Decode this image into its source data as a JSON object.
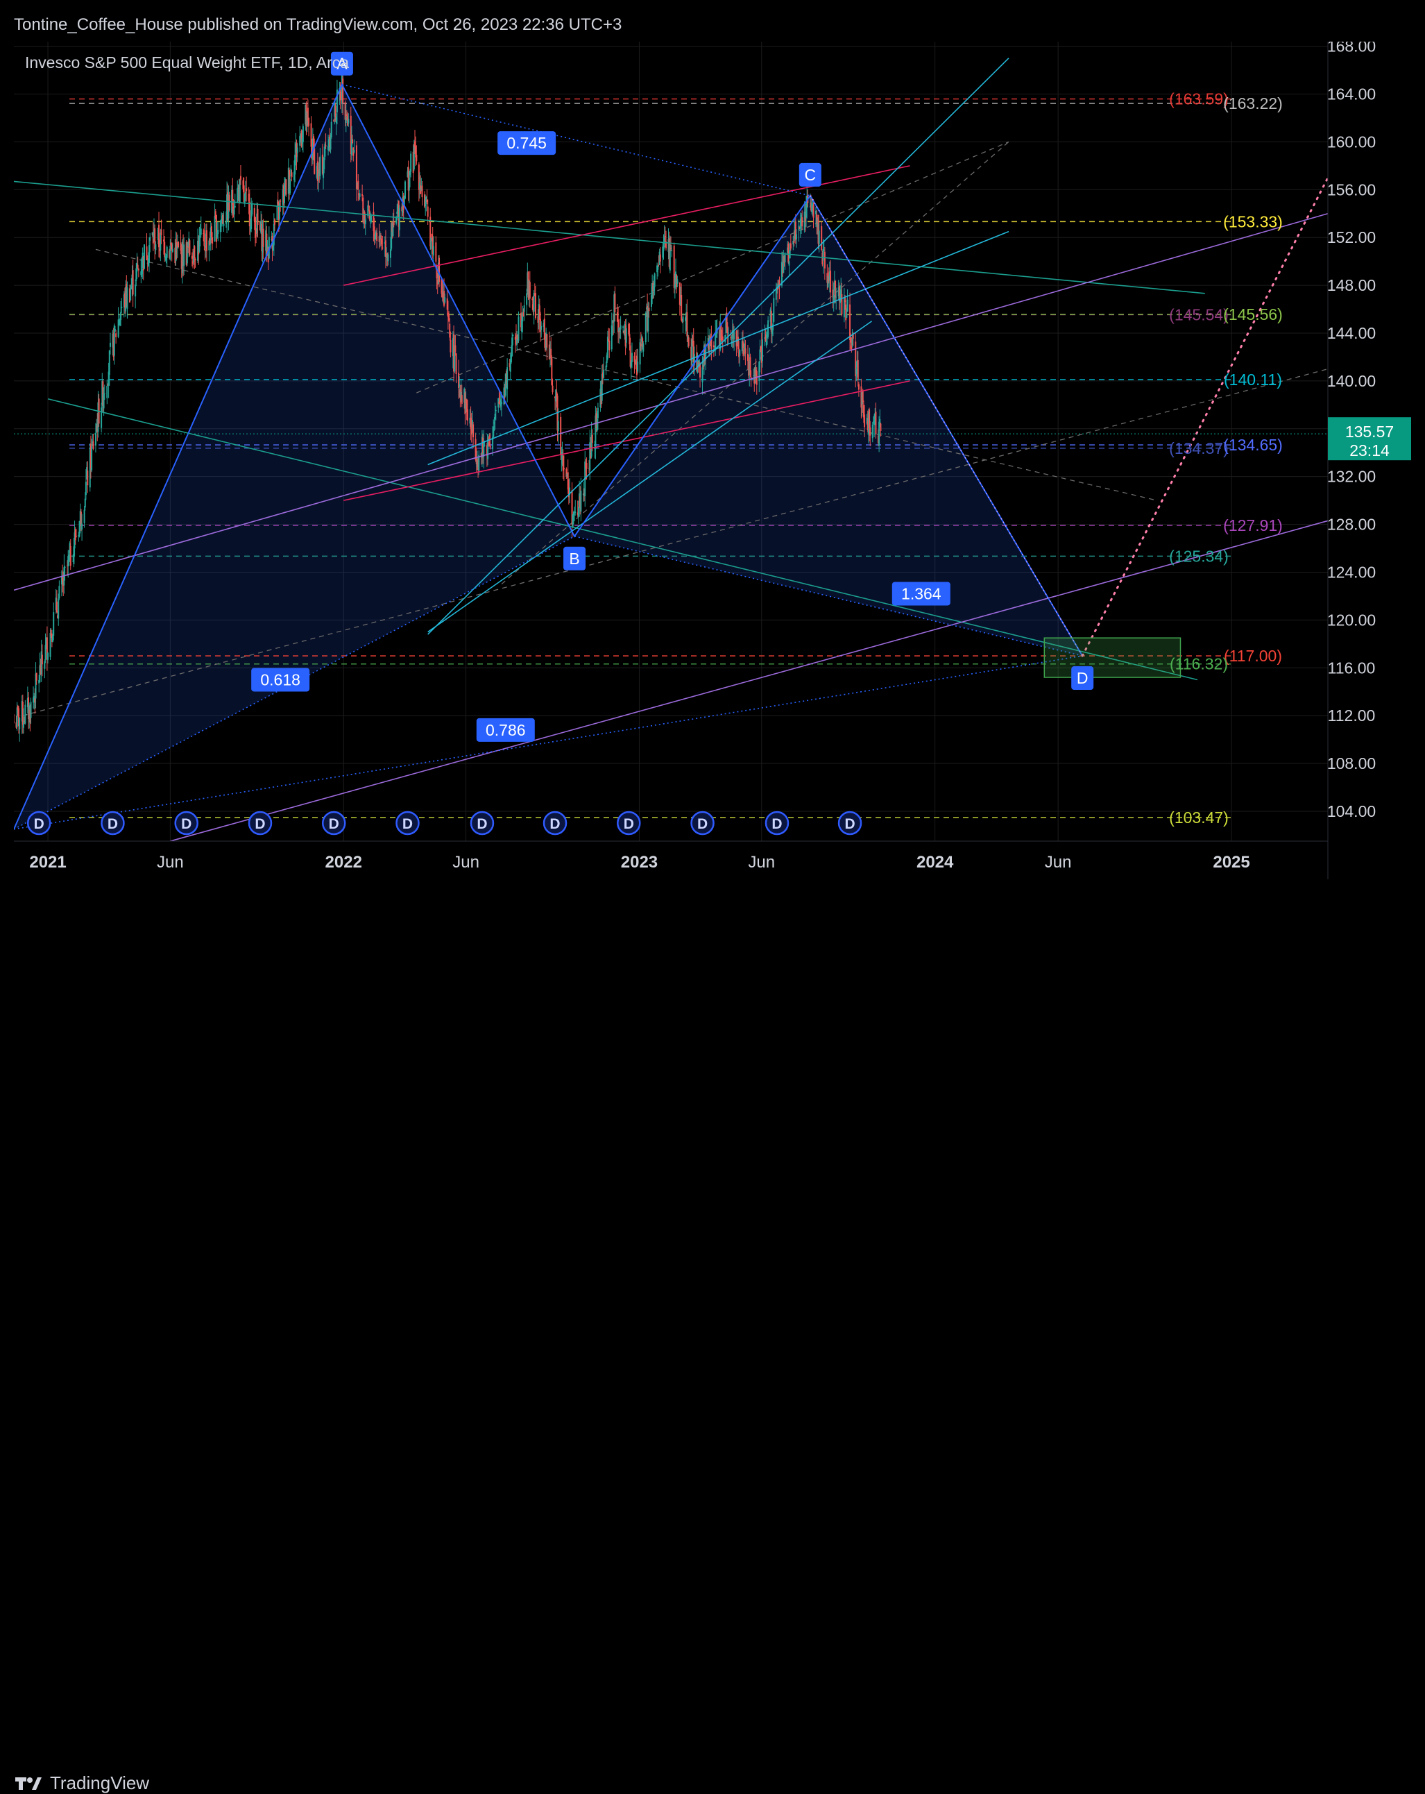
{
  "header": {
    "publisher_line": "Tontine_Coffee_House published on TradingView.com, Oct 26, 2023 22:36 UTC+3"
  },
  "footer": {
    "brand": "TradingView"
  },
  "colors": {
    "background": "#000000",
    "grid": "#1c1c1c",
    "axis_text": "#d1d4dc",
    "candle_up": "#26a69a",
    "candle_down": "#ef5350",
    "pattern_blue": "#2962ff",
    "teal_line": "#1b9e8e",
    "cyan_line": "#23b7d8",
    "pink_line": "#e91e63",
    "purple_line": "#9c6bdc",
    "target_box": "#3fa34d",
    "last_price_bg": "#089981"
  },
  "chart_data": {
    "type": "candlestick",
    "title": "Invesco S&P 500 Equal Weight ETF, 1D, Arca",
    "x_range": [
      "2020-11-20",
      "2025-04-30"
    ],
    "ylim": [
      101.5,
      168.5
    ],
    "y_ticks": [
      104,
      108,
      112,
      116,
      120,
      124,
      128,
      132,
      136,
      140,
      144,
      148,
      152,
      156,
      160,
      164,
      168
    ],
    "y_tick_labels": [
      "104.00",
      "108.00",
      "112.00",
      "116.00",
      "120.00",
      "124.00",
      "128.00",
      "132.00",
      "136.00",
      "140.00",
      "144.00",
      "148.00",
      "152.00",
      "156.00",
      "160.00",
      "164.00",
      "168.00"
    ],
    "x_ticks": [
      {
        "date": "2021-01-01",
        "label": "2021",
        "bold": true
      },
      {
        "date": "2021-06-01",
        "label": "Jun",
        "bold": false
      },
      {
        "date": "2022-01-01",
        "label": "2022",
        "bold": true
      },
      {
        "date": "2022-06-01",
        "label": "Jun",
        "bold": false
      },
      {
        "date": "2023-01-01",
        "label": "2023",
        "bold": true
      },
      {
        "date": "2023-06-01",
        "label": "Jun",
        "bold": false
      },
      {
        "date": "2024-01-01",
        "label": "2024",
        "bold": true
      },
      {
        "date": "2024-06-01",
        "label": "Jun",
        "bold": false
      },
      {
        "date": "2025-01-01",
        "label": "2025",
        "bold": true
      }
    ],
    "last_price": {
      "value": 135.57,
      "label": "135.57",
      "countdown": "23:14"
    },
    "price_path": [
      {
        "date": "2020-11-20",
        "value": 111.5
      },
      {
        "date": "2020-12-10",
        "value": 112.5
      },
      {
        "date": "2021-01-10",
        "value": 120.5
      },
      {
        "date": "2021-02-10",
        "value": 128.5
      },
      {
        "date": "2021-03-05",
        "value": 137.5
      },
      {
        "date": "2021-04-01",
        "value": 146.0
      },
      {
        "date": "2021-05-10",
        "value": 152.0
      },
      {
        "date": "2021-06-15",
        "value": 150.5
      },
      {
        "date": "2021-07-20",
        "value": 152.0
      },
      {
        "date": "2021-08-25",
        "value": 156.0
      },
      {
        "date": "2021-09-30",
        "value": 151.0
      },
      {
        "date": "2021-11-15",
        "value": 162.0
      },
      {
        "date": "2021-12-01",
        "value": 157.0
      },
      {
        "date": "2021-12-30",
        "value": 164.8
      },
      {
        "date": "2022-01-25",
        "value": 154.0
      },
      {
        "date": "2022-02-25",
        "value": 151.0
      },
      {
        "date": "2022-03-30",
        "value": 159.0
      },
      {
        "date": "2022-04-25",
        "value": 150.0
      },
      {
        "date": "2022-05-20",
        "value": 141.0
      },
      {
        "date": "2022-06-17",
        "value": 133.5
      },
      {
        "date": "2022-07-05",
        "value": 136.0
      },
      {
        "date": "2022-08-16",
        "value": 148.0
      },
      {
        "date": "2022-09-10",
        "value": 143.0
      },
      {
        "date": "2022-09-30",
        "value": 133.0
      },
      {
        "date": "2022-10-13",
        "value": 128.0
      },
      {
        "date": "2022-11-05",
        "value": 135.0
      },
      {
        "date": "2022-12-01",
        "value": 146.0
      },
      {
        "date": "2022-12-28",
        "value": 141.0
      },
      {
        "date": "2023-02-02",
        "value": 152.0
      },
      {
        "date": "2023-03-13",
        "value": 141.0
      },
      {
        "date": "2023-04-18",
        "value": 145.0
      },
      {
        "date": "2023-05-25",
        "value": 140.0
      },
      {
        "date": "2023-06-30",
        "value": 150.0
      },
      {
        "date": "2023-07-31",
        "value": 155.5
      },
      {
        "date": "2023-08-25",
        "value": 148.0
      },
      {
        "date": "2023-09-15",
        "value": 146.0
      },
      {
        "date": "2023-10-05",
        "value": 137.0
      },
      {
        "date": "2023-10-26",
        "value": 135.57
      }
    ],
    "horizontal_levels": [
      {
        "value": 163.59,
        "label": "(163.59)",
        "color": "#e53935",
        "label_side": "inner"
      },
      {
        "value": 163.22,
        "label": "(163.22)",
        "color": "#bdbdbd",
        "label_side": "outer"
      },
      {
        "value": 153.33,
        "label": "(153.33)",
        "color": "#ffeb3b",
        "label_side": "outer"
      },
      {
        "value": 145.54,
        "label": "(145.54)",
        "color": "#8e3b7c",
        "label_side": "inner"
      },
      {
        "value": 145.56,
        "label": "(145.56)",
        "color": "#8bc34a",
        "label_side": "outer"
      },
      {
        "value": 140.11,
        "label": "(140.11)",
        "color": "#00bcd4",
        "label_side": "outer"
      },
      {
        "value": 134.37,
        "label": "(134.37)",
        "color": "#3f51b5",
        "label_side": "inner"
      },
      {
        "value": 134.65,
        "label": "(134.65)",
        "color": "#536dfe",
        "label_side": "outer"
      },
      {
        "value": 127.91,
        "label": "(127.91)",
        "color": "#ab47bc",
        "label_side": "outer"
      },
      {
        "value": 125.34,
        "label": "(125.34)",
        "color": "#26a69a",
        "label_side": "inner"
      },
      {
        "value": 117.0,
        "label": "(117.00)",
        "color": "#f44336",
        "label_side": "outer"
      },
      {
        "value": 116.32,
        "label": "(116.32)",
        "color": "#4caf50",
        "label_side": "inner"
      },
      {
        "value": 103.47,
        "label": "(103.47)",
        "color": "#cddc39",
        "label_side": "inner"
      }
    ],
    "harmonic_points": [
      {
        "label": "A",
        "date": "2021-12-30",
        "value": 164.8,
        "label_pos": "above"
      },
      {
        "label": "B",
        "date": "2022-10-13",
        "value": 127.0,
        "label_pos": "below"
      },
      {
        "label": "C",
        "date": "2023-07-31",
        "value": 155.5,
        "label_pos": "above"
      },
      {
        "label": "D",
        "date": "2024-07-01",
        "value": 117.0,
        "label_pos": "below"
      }
    ],
    "ratios": [
      {
        "label": "0.745",
        "date": "2022-08-15",
        "value": 159.9
      },
      {
        "label": "1.364",
        "date": "2023-12-15",
        "value": 122.2
      },
      {
        "label": "0.618",
        "date": "2021-10-15",
        "value": 115.0
      },
      {
        "label": "0.786",
        "date": "2022-07-20",
        "value": 110.8
      }
    ],
    "target_zone": {
      "start": "2024-05-15",
      "end": "2024-10-30",
      "low": 115.2,
      "high": 118.5
    },
    "dividends": {
      "label": "D",
      "dates": [
        "2020-12-21",
        "2021-03-22",
        "2021-06-21",
        "2021-09-20",
        "2021-12-20",
        "2022-03-21",
        "2022-06-21",
        "2022-09-19",
        "2022-12-19",
        "2023-03-20",
        "2023-06-20",
        "2023-09-18"
      ]
    }
  }
}
